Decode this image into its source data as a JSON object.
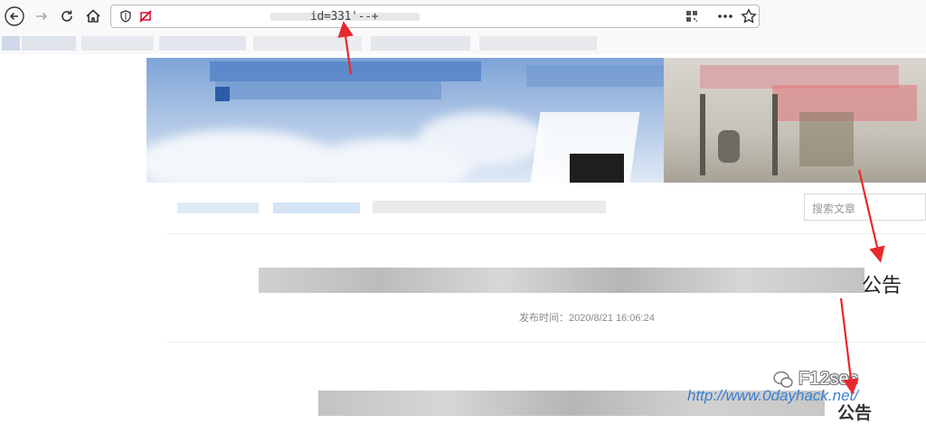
{
  "browser": {
    "url_suffix": "id=331'--+",
    "icons": [
      "back-icon",
      "forward-icon",
      "reload-icon",
      "home-icon",
      "shield-icon",
      "tracking-blocked-icon",
      "qr-code-icon",
      "more-icon",
      "bookmark-star-icon"
    ]
  },
  "site": {
    "search_placeholder": "搜索文章",
    "article_title_suffix": "公告",
    "publish_time": "发布时间：2020/8/21 16:06:24",
    "second_title_suffix": "公告"
  },
  "watermark": {
    "brand": "F12sec",
    "url": "http://www.0dayhack.net/"
  },
  "colors": {
    "arrow": "#e8282c",
    "watermark_link": "#3b7fd0"
  }
}
